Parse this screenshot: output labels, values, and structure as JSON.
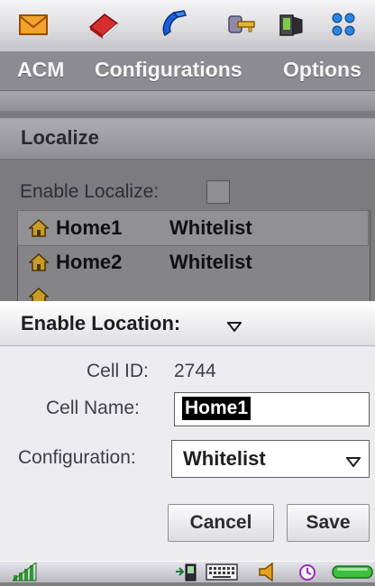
{
  "app_icons": [
    {
      "icon": "envelope-icon"
    },
    {
      "icon": "book-icon"
    },
    {
      "icon": "phone-icon"
    },
    {
      "icon": "keys-icon"
    },
    {
      "icon": "device-icon"
    },
    {
      "icon": "apps-grid-icon"
    }
  ],
  "menu": {
    "items": [
      "ACM",
      "Configurations",
      "Options"
    ]
  },
  "localize": {
    "title": "Localize",
    "enable_label": "Enable Localize:",
    "enable_checked": false,
    "rows": [
      {
        "name": "Home1",
        "config": "Whitelist",
        "selected": true
      },
      {
        "name": "Home2",
        "config": "Whitelist",
        "selected": false
      }
    ]
  },
  "dialog": {
    "title": "Enable Location:",
    "cell_id_label": "Cell ID:",
    "cell_id_value": "2744",
    "cell_name_label": "Cell Name:",
    "cell_name_value": "Home1",
    "configuration_label": "Configuration:",
    "configuration_value": "Whitelist",
    "cancel_label": "Cancel",
    "save_label": "Save"
  },
  "status": {
    "icons": [
      "signal-icon",
      "phone-sync-icon",
      "keyboard-icon",
      "speaker-icon",
      "clock-icon",
      "battery-icon"
    ]
  },
  "colors": {
    "menu_bg": "#8b8b91",
    "dialog_bg": "#ececf0",
    "dim_bg": "#7b7b80",
    "selection": "#000000"
  }
}
